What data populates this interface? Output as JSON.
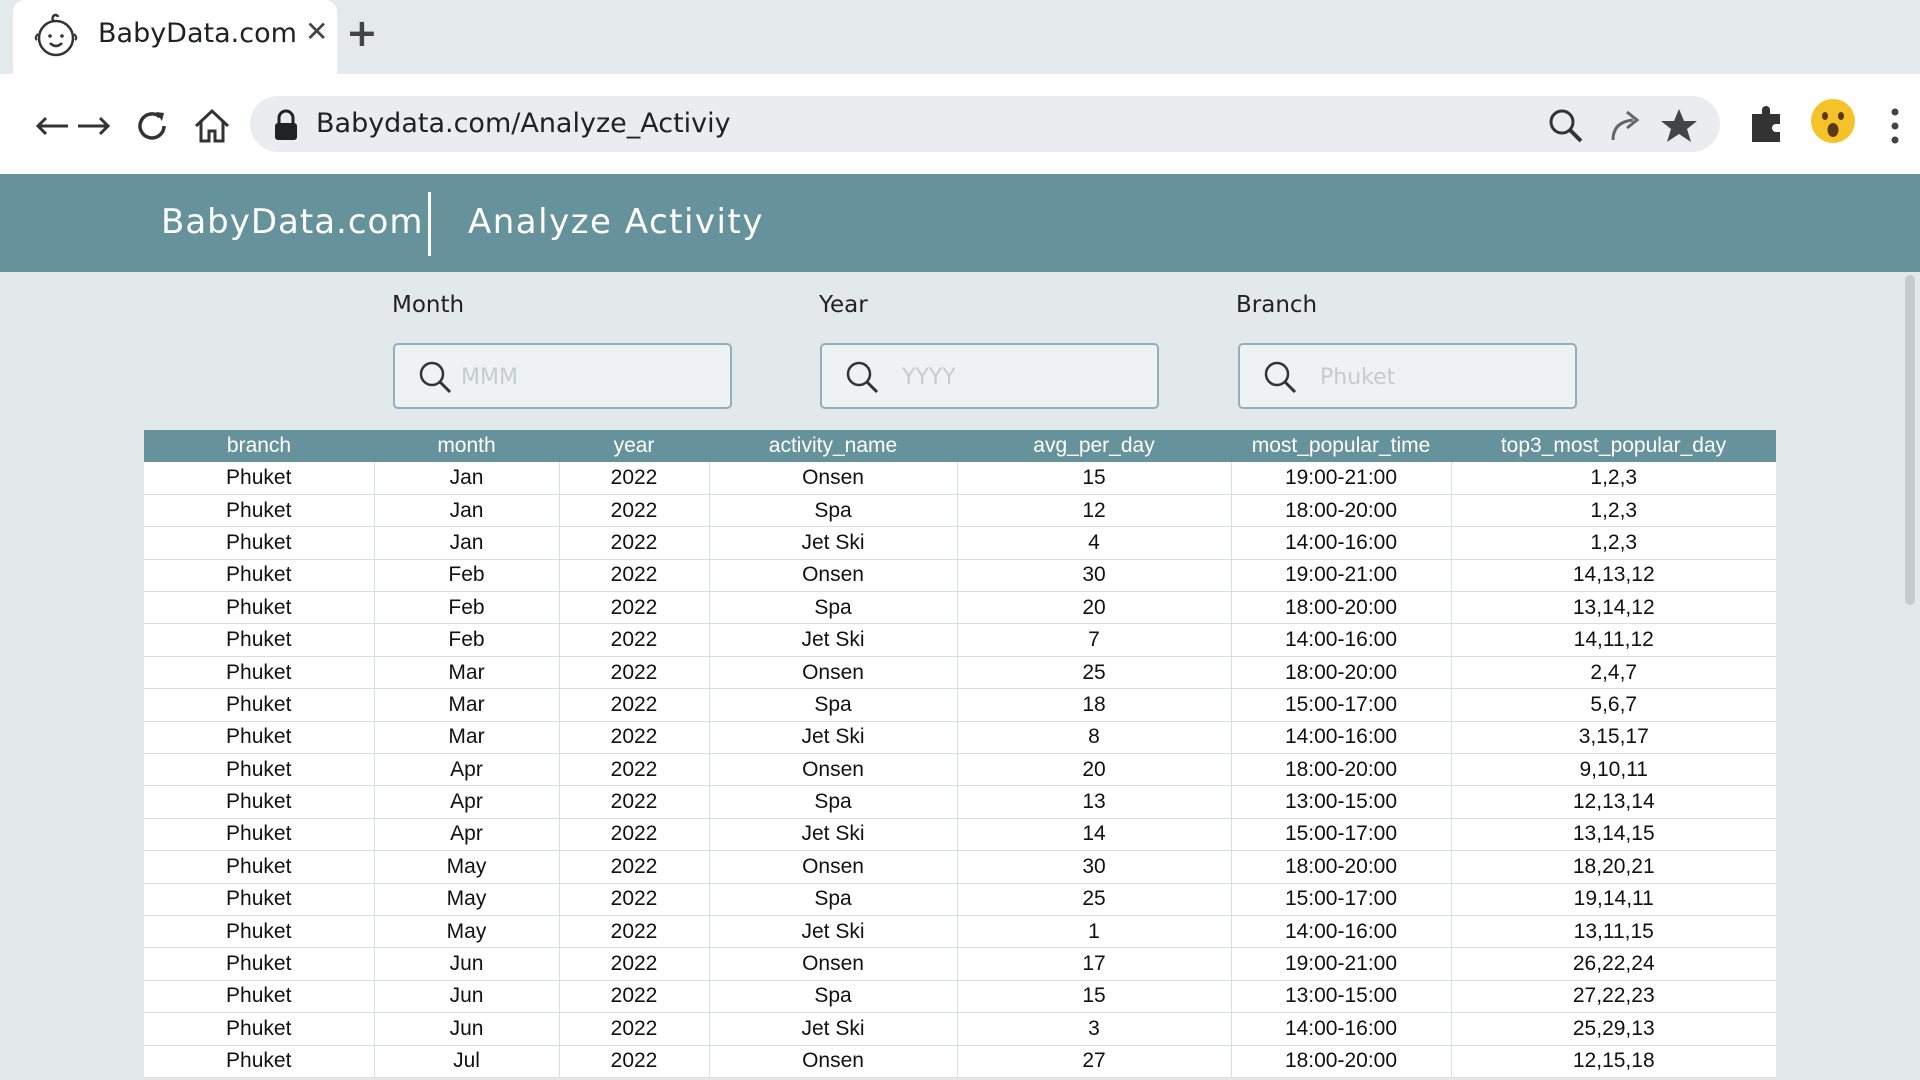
{
  "browser": {
    "tab_title": "BabyData.com",
    "tab_close": "✕",
    "new_tab": "+",
    "url": "Babydata.com/Analyze_Activiy"
  },
  "app": {
    "brand": "BabyData.com",
    "page_title": "Analyze Activity"
  },
  "filters": {
    "month": {
      "label": "Month",
      "placeholder": "MMM"
    },
    "year": {
      "label": "Year",
      "placeholder": "YYYY"
    },
    "branch": {
      "label": "Branch",
      "placeholder": "Phuket"
    }
  },
  "table": {
    "columns": [
      "branch",
      "month",
      "year",
      "activity_name",
      "avg_per_day",
      "most_popular_time",
      "top3_most_popular_day"
    ],
    "rows": [
      [
        "Phuket",
        "Jan",
        "2022",
        "Onsen",
        "15",
        "19:00-21:00",
        "1,2,3"
      ],
      [
        "Phuket",
        "Jan",
        "2022",
        "Spa",
        "12",
        "18:00-20:00",
        "1,2,3"
      ],
      [
        "Phuket",
        "Jan",
        "2022",
        "Jet Ski",
        "4",
        "14:00-16:00",
        "1,2,3"
      ],
      [
        "Phuket",
        "Feb",
        "2022",
        "Onsen",
        "30",
        "19:00-21:00",
        "14,13,12"
      ],
      [
        "Phuket",
        "Feb",
        "2022",
        "Spa",
        "20",
        "18:00-20:00",
        "13,14,12"
      ],
      [
        "Phuket",
        "Feb",
        "2022",
        "Jet Ski",
        "7",
        "14:00-16:00",
        "14,11,12"
      ],
      [
        "Phuket",
        "Mar",
        "2022",
        "Onsen",
        "25",
        "18:00-20:00",
        "2,4,7"
      ],
      [
        "Phuket",
        "Mar",
        "2022",
        "Spa",
        "18",
        "15:00-17:00",
        "5,6,7"
      ],
      [
        "Phuket",
        "Mar",
        "2022",
        "Jet Ski",
        "8",
        "14:00-16:00",
        "3,15,17"
      ],
      [
        "Phuket",
        "Apr",
        "2022",
        "Onsen",
        "20",
        "18:00-20:00",
        "9,10,11"
      ],
      [
        "Phuket",
        "Apr",
        "2022",
        "Spa",
        "13",
        "13:00-15:00",
        "12,13,14"
      ],
      [
        "Phuket",
        "Apr",
        "2022",
        "Jet Ski",
        "14",
        "15:00-17:00",
        "13,14,15"
      ],
      [
        "Phuket",
        "May",
        "2022",
        "Onsen",
        "30",
        "18:00-20:00",
        "18,20,21"
      ],
      [
        "Phuket",
        "May",
        "2022",
        "Spa",
        "25",
        "15:00-17:00",
        "19,14,11"
      ],
      [
        "Phuket",
        "May",
        "2022",
        "Jet Ski",
        "1",
        "14:00-16:00",
        "13,11,15"
      ],
      [
        "Phuket",
        "Jun",
        "2022",
        "Onsen",
        "17",
        "19:00-21:00",
        "26,22,24"
      ],
      [
        "Phuket",
        "Jun",
        "2022",
        "Spa",
        "15",
        "13:00-15:00",
        "27,22,23"
      ],
      [
        "Phuket",
        "Jun",
        "2022",
        "Jet Ski",
        "3",
        "14:00-16:00",
        "25,29,13"
      ],
      [
        "Phuket",
        "Jul",
        "2022",
        "Onsen",
        "27",
        "18:00-20:00",
        "12,15,18"
      ]
    ]
  },
  "icons": {
    "favicon": "baby-face-icon",
    "back": "arrow-left-icon",
    "forward": "arrow-right-icon",
    "reload": "reload-icon",
    "home": "home-icon",
    "lock": "lock-icon",
    "search": "search-icon",
    "share": "share-icon",
    "bookmark": "star-icon",
    "extensions": "puzzle-icon",
    "profile": "surprised-emoji-icon",
    "menu": "kebab-menu-icon"
  },
  "colors": {
    "accent": "#66929b",
    "page_bg": "#e3e8ea"
  }
}
